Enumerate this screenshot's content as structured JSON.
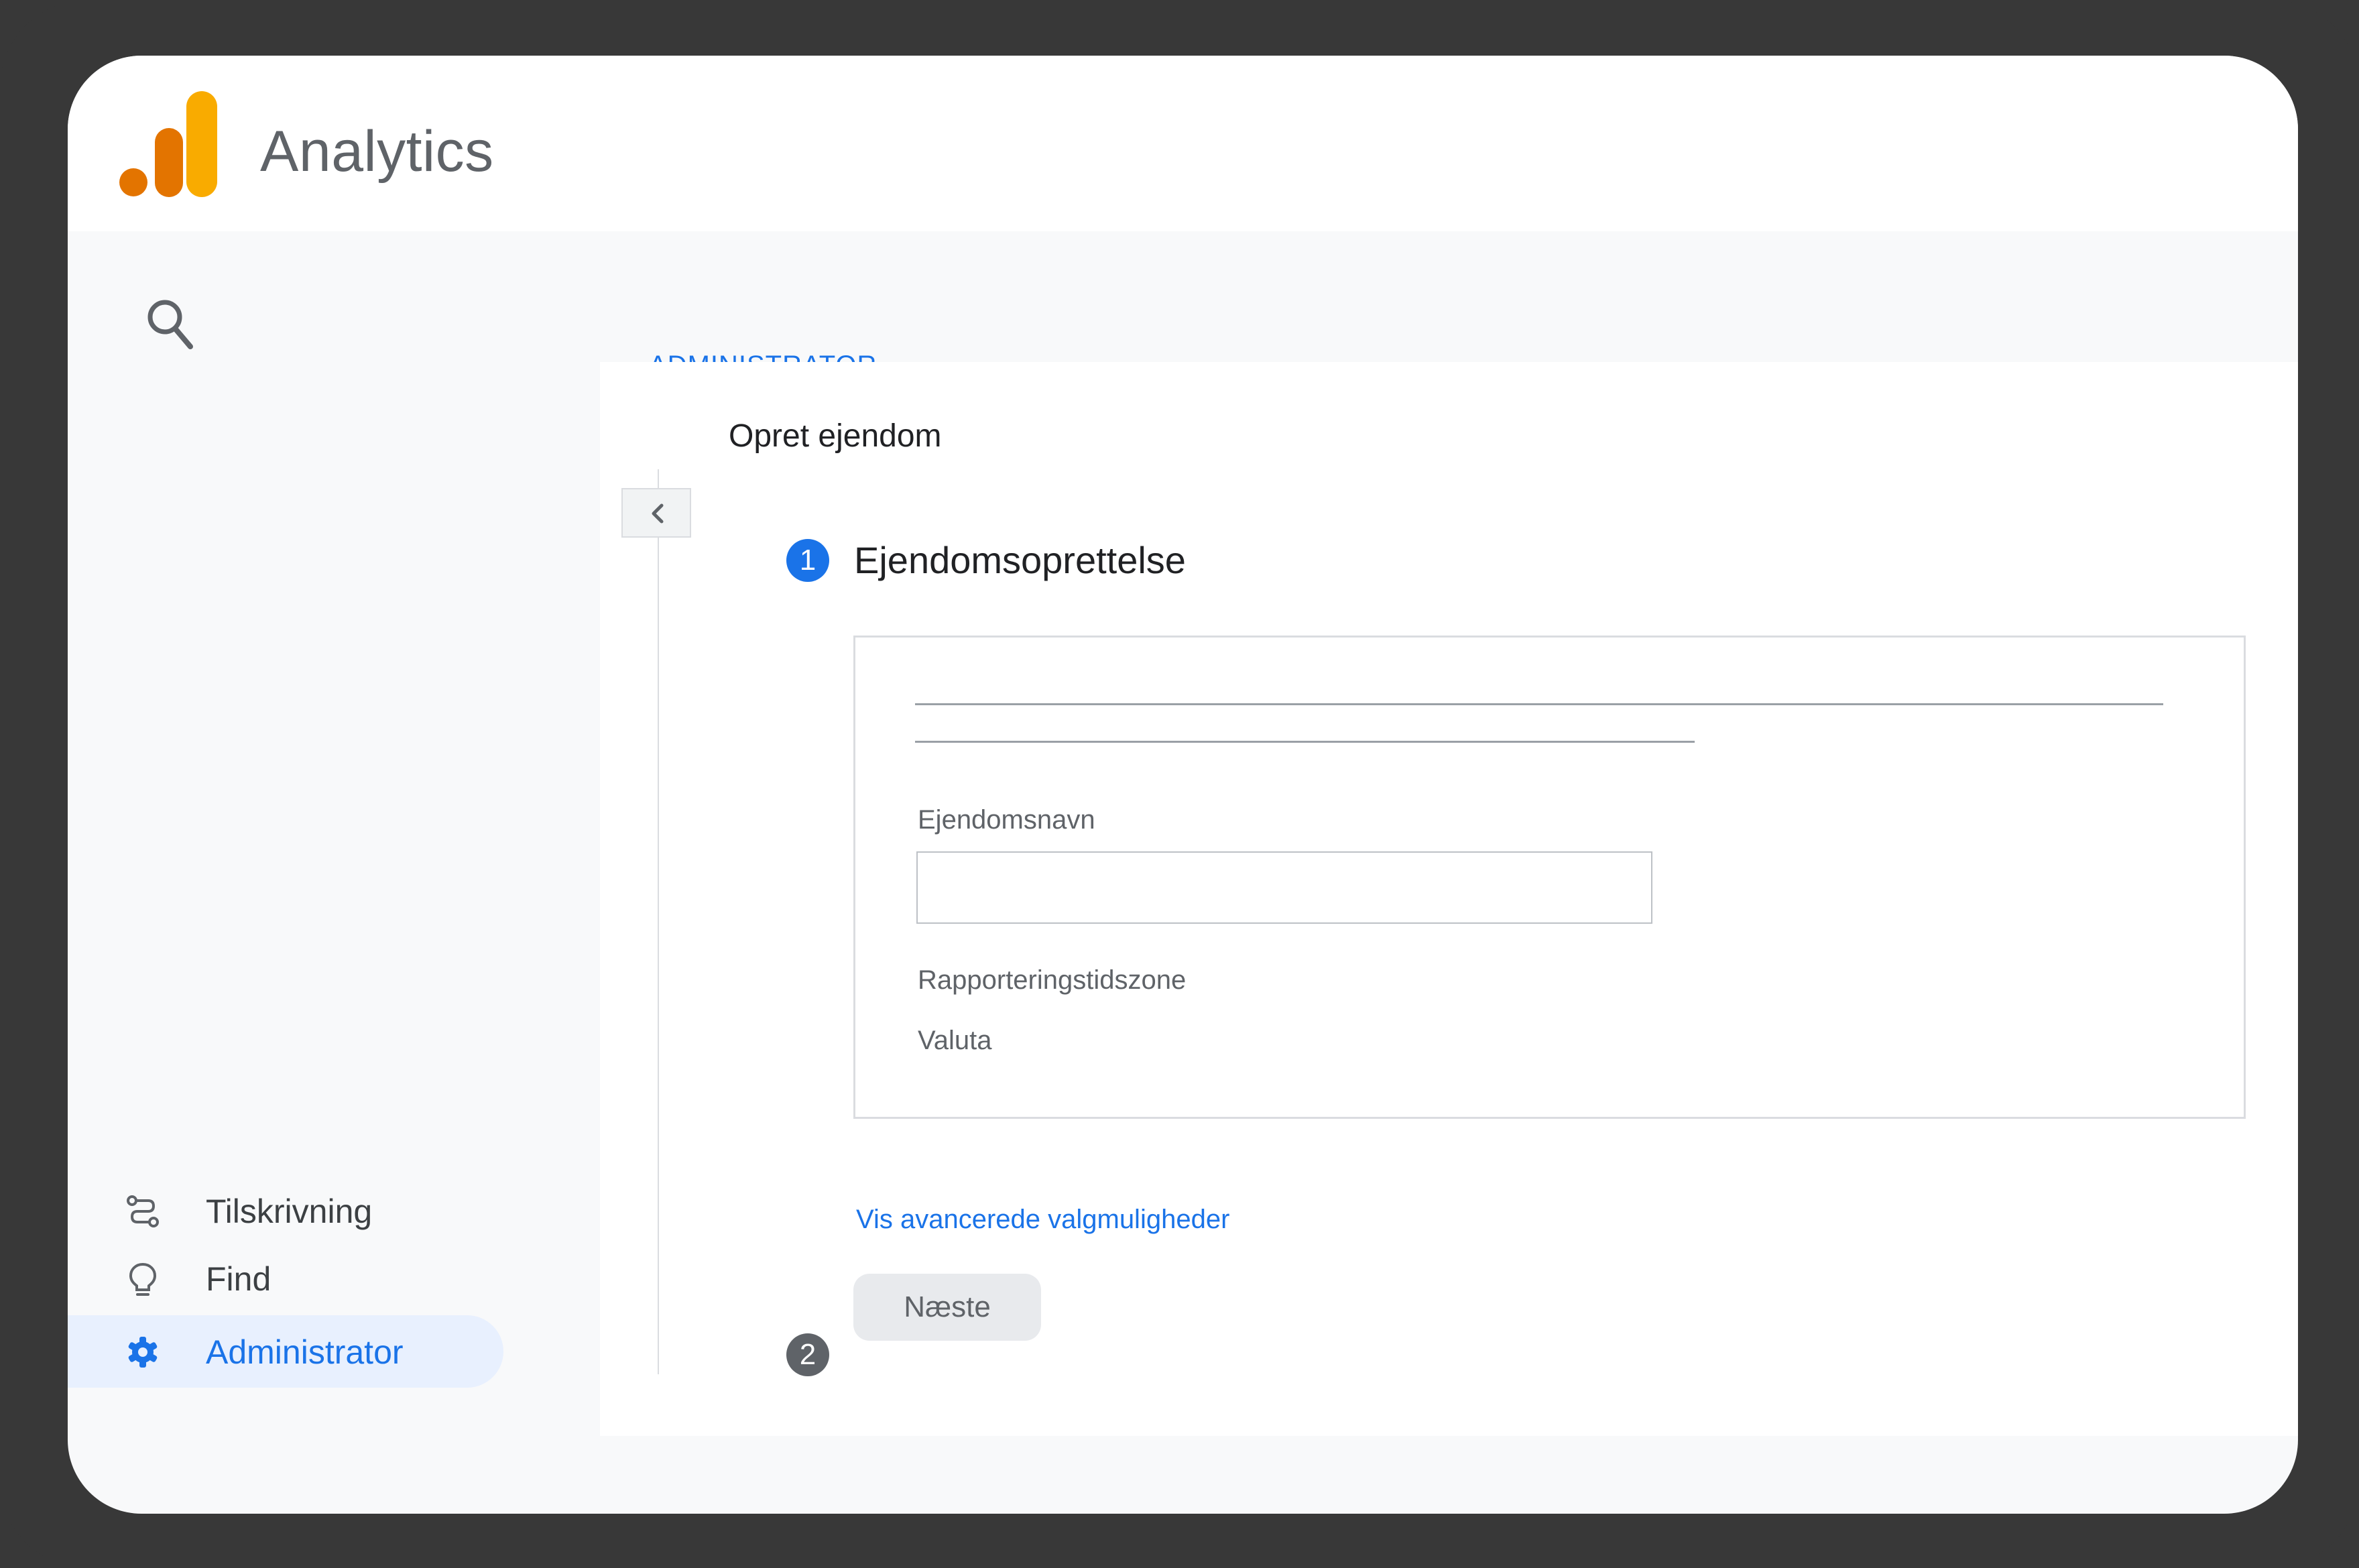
{
  "app": {
    "title": "Analytics"
  },
  "icons": {
    "logo": "analytics-logo-icon",
    "search": "search-icon",
    "attribution": "route-icon",
    "explore": "lightbulb-icon",
    "admin": "gear-icon",
    "collapse": "chevron-left-icon"
  },
  "colors": {
    "accent": "#1a73e8",
    "logo_dark": "#e37400",
    "logo_light": "#f9ab00",
    "tab_underline": "#f4b400",
    "active_nav_bg": "#e8f0fe"
  },
  "nav": {
    "items": [
      {
        "label": "Tilskrivning",
        "active": false
      },
      {
        "label": "Find",
        "active": false
      },
      {
        "label": "Administrator",
        "active": true
      }
    ]
  },
  "tabs": [
    {
      "label": "ADMINISTRATOR",
      "active": true
    }
  ],
  "main": {
    "page_title": "Opret ejendom",
    "step1": {
      "number": "1",
      "title": "Ejendomsoprettelse",
      "form": {
        "property_name_label": "Ejendomsnavn",
        "property_name_value": "",
        "timezone_label": "Rapporteringstidszone",
        "currency_label": "Valuta"
      },
      "advanced_link": "Vis avancerede valgmuligheder",
      "next_button": "Næste"
    },
    "step2": {
      "number": "2"
    }
  }
}
